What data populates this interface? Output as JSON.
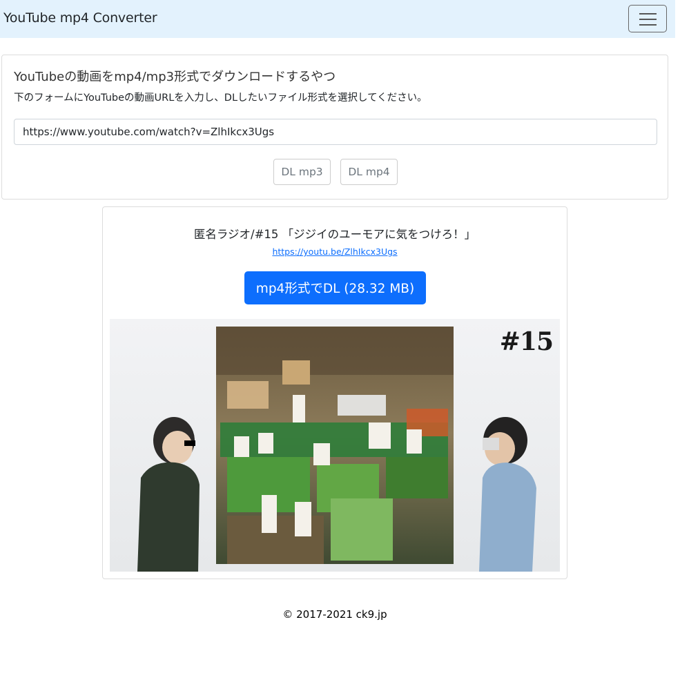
{
  "navbar": {
    "brand": "YouTube mp4 Converter",
    "menu_icon": "hamburger-icon"
  },
  "form_card": {
    "title": "YouTubeの動画をmp4/mp3形式でダウンロードするやつ",
    "description": "下のフォームにYouTubeの動画URLを入力し、DLしたいファイル形式を選択してください。",
    "url_value": "https://www.youtube.com/watch?v=ZlhIkcx3Ugs",
    "mp3_button": "DL mp3",
    "mp4_button": "DL mp4"
  },
  "result_card": {
    "video_title": "匿名ラジオ/#15 「ジジイのユーモアに気をつけろ！」",
    "video_link": "https://youtu.be/ZlhIkcx3Ugs",
    "download_button": "mp4形式でDL (28.32 MB)",
    "thumbnail_number": "#15"
  },
  "footer": {
    "copyright": "© 2017-2021 ck9.jp"
  },
  "colors": {
    "navbar_bg": "#e3f2fd",
    "primary": "#0d6efd",
    "link": "#0d6efd"
  }
}
